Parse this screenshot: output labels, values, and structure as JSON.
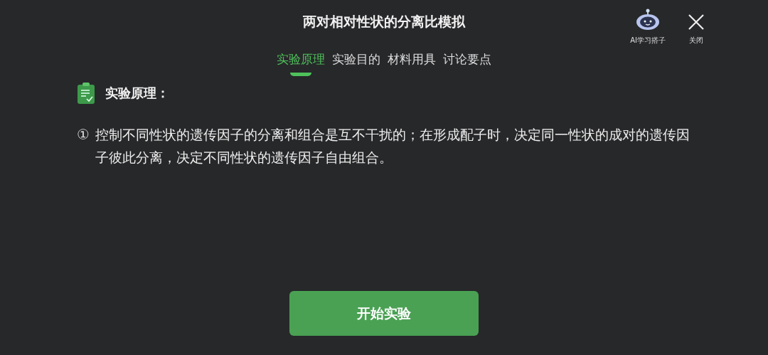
{
  "header": {
    "title": "两对相对性状的分离比模拟",
    "actions": [
      {
        "kind": "robot",
        "label": "AI学习搭子"
      },
      {
        "kind": "close",
        "label": "关闭"
      }
    ]
  },
  "tabs": [
    {
      "label": "实验原理",
      "selected": true
    },
    {
      "label": "实验目的",
      "selected": false
    },
    {
      "label": "材料用具",
      "selected": false
    },
    {
      "label": "讨论要点",
      "selected": false
    }
  ],
  "section": {
    "heading": "实验原理：",
    "items": [
      {
        "marker": "①",
        "text": "控制不同性状的遗传因子的分离和组合是互不干扰的；在形成配子时，决定同一性状的成对的遗传因子彼此分离，决定不同性状的遗传因子自由组合。"
      }
    ]
  },
  "start_button": "开始实验"
}
